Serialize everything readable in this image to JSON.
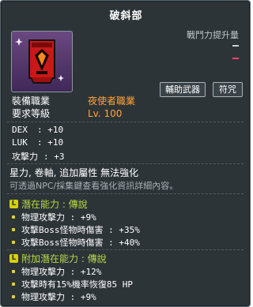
{
  "item": {
    "name": "破斜部",
    "power_label": "戰鬥力提升量"
  },
  "requirements": {
    "job_label": "裝備職業",
    "job_value": "夜使者職業",
    "level_label": "要求等級",
    "level_value": "Lv. 100"
  },
  "buttons": {
    "secondary_weapon": "輔助武器",
    "symbol": "符咒"
  },
  "stats": [
    {
      "key": "DEX",
      "value": ": +10"
    },
    {
      "key": "LUK",
      "value": ": +10"
    },
    {
      "key": "攻擊力",
      "value": ": +3"
    }
  ],
  "description": "星力, 卷軸, 追加屬性 無法強化",
  "hint": "可透過NPC/採集鍵查看強化資訊詳細內容。",
  "potential": {
    "title": "潛在能力 : 傳說",
    "lines": [
      "物理攻擊力 : +9%",
      "攻擊Boss怪物時傷害 : +35%",
      "攻擊Boss怪物時傷害 : +40%"
    ]
  },
  "additional_potential": {
    "title": "附加潛在能力 : 傳說",
    "lines": [
      "物理攻擊力 : +12%",
      "攻擊時有15%機率恢復85 HP",
      "物理攻擊力 : +9%"
    ]
  },
  "colors": {
    "background": "#2d3438",
    "accent_orange": "#ffa33a",
    "potential_green": "#b7d94a",
    "bullet_yellow": "#e2cf3e"
  }
}
